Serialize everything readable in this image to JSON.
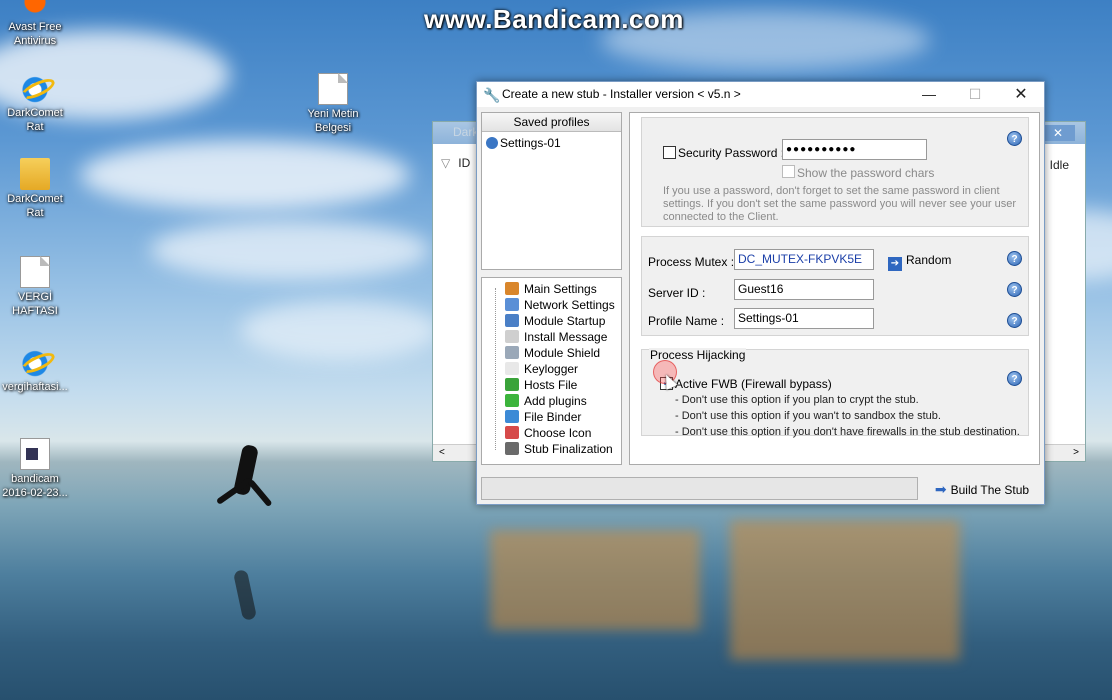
{
  "watermark": "www.Bandicam.com",
  "desktop_icons": [
    {
      "label": "Avast Free\nAntivirus",
      "icon": "avast-icon"
    },
    {
      "label": "DarkComet\nRat",
      "icon": "ie-icon"
    },
    {
      "label": "DarkComet\nRat",
      "icon": "folder-icon"
    },
    {
      "label": "VERGİ\nHAFTASI",
      "icon": "document-icon"
    },
    {
      "label": "vergihaftasi...",
      "icon": "ie-icon"
    },
    {
      "label": "bandicam\n2016-02-23...",
      "icon": "bandicam-icon"
    },
    {
      "label": "Yeni Metin\nBelgesi",
      "icon": "document-icon"
    }
  ],
  "background_window": {
    "title": "Dark",
    "column_id": "ID",
    "column_status": "Idle",
    "close_glyph": "✕"
  },
  "dialog": {
    "title": "Create a new stub - Installer version < v5.n >",
    "saved_profiles_header": "Saved profiles",
    "profiles": [
      "Settings-01"
    ],
    "nav_items": [
      {
        "label": "Main Settings",
        "icon": "home-icon",
        "color": "#d9862b"
      },
      {
        "label": "Network Settings",
        "icon": "network-icon",
        "color": "#5a8fd6"
      },
      {
        "label": "Module Startup",
        "icon": "startup-icon",
        "color": "#4a7fc6"
      },
      {
        "label": "Install Message",
        "icon": "message-icon",
        "color": "#cfcfcf"
      },
      {
        "label": "Module Shield",
        "icon": "shield-icon",
        "color": "#9aa8b8"
      },
      {
        "label": "Keylogger",
        "icon": "keylogger-icon",
        "color": "#e8e8e8"
      },
      {
        "label": "Hosts File",
        "icon": "leaf-icon",
        "color": "#3aa33a"
      },
      {
        "label": "Add plugins",
        "icon": "puzzle-icon",
        "color": "#3cb43c"
      },
      {
        "label": "File Binder",
        "icon": "binder-icon",
        "color": "#3c8ad6"
      },
      {
        "label": "Choose Icon",
        "icon": "choose-icon-icon",
        "color": "#d64a4a"
      },
      {
        "label": "Stub Finalization",
        "icon": "finalize-icon",
        "color": "#6a6a6a"
      }
    ],
    "security": {
      "password_label": "Security Password :",
      "password_value": "●●●●●●●●●●",
      "show_chars_label": "Show the password chars",
      "note": "If you use a password, don't forget to set the same password in client settings. If you don't set the same password you will never see your user connected to the Client."
    },
    "identity": {
      "mutex_label": "Process Mutex :",
      "mutex_value": "DC_MUTEX-FKPVK5E",
      "random_label": "Random",
      "server_id_label": "Server ID :",
      "server_id_value": "Guest16",
      "profile_name_label": "Profile Name :",
      "profile_name_value": "Settings-01"
    },
    "hijacking": {
      "group_title": "Process Hijacking",
      "fwb_label": "Active FWB (Firewall bypass)",
      "hints": [
        "- Don't use this option if you plan to crypt the stub.",
        "- Don't use this option if you wan't to sandbox the stub.",
        "- Don't use this option if you don't have firewalls in the stub destination."
      ]
    },
    "help_glyph": "?",
    "build_label": "Build The Stub"
  }
}
